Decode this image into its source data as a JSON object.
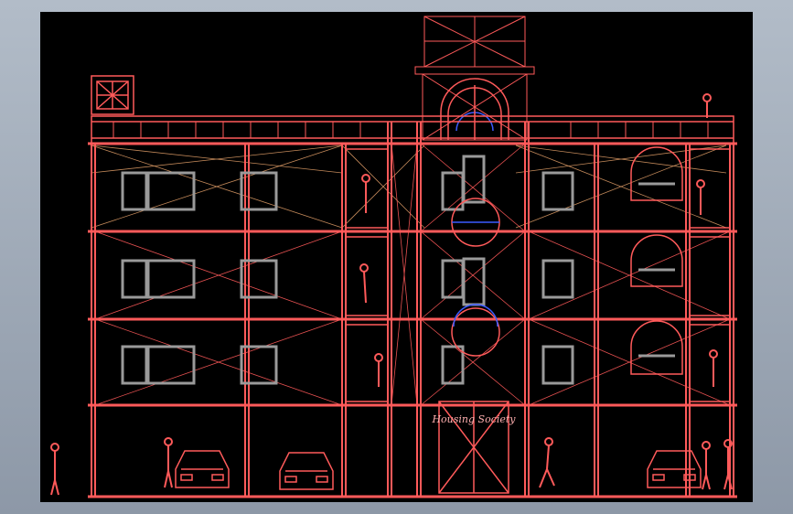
{
  "drawing": {
    "sign_text": "Housing Society",
    "colors": {
      "background": "#000000",
      "frame": "#a7b1bf",
      "structure": "#ff5a5a",
      "guides": "#e6a26a",
      "glass": "#9a9a9a",
      "accent_blue": "#3b5bff"
    }
  }
}
